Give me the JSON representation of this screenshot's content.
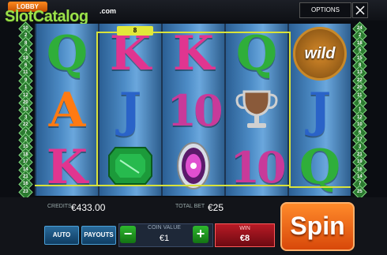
{
  "topbar": {
    "lobby_label": "LOBBY",
    "logo_text": "SlotCatalog",
    "logo_suffix": ".com",
    "options_label": "OPTIONS",
    "close_icon": "close-icon"
  },
  "paylines": {
    "left": [
      "10",
      "2",
      "8",
      "4",
      "19",
      "6",
      "11",
      "9",
      "1",
      "12",
      "20",
      "13",
      "3",
      "22",
      "7",
      "5",
      "15",
      "18",
      "17",
      "14",
      "21",
      "16",
      "23"
    ],
    "right": [
      "24",
      "2",
      "18",
      "5",
      "15",
      "8",
      "13",
      "22",
      "20",
      "11",
      "9",
      "1",
      "12",
      "10",
      "6",
      "17",
      "3",
      "21",
      "19",
      "16",
      "14",
      "7",
      "25"
    ]
  },
  "winline": {
    "tag": "8",
    "color": "#d9e23a"
  },
  "reels": [
    [
      {
        "sym": "Q",
        "color": "#2fae3a"
      },
      {
        "sym": "A",
        "color": "#ff7a12"
      },
      {
        "sym": "K",
        "color": "#e03590"
      }
    ],
    [
      {
        "sym": "K",
        "color": "#e03590"
      },
      {
        "sym": "J",
        "color": "#2a63c8"
      },
      {
        "sym": "emerald-gem-icon",
        "color": "#1c9a3a"
      }
    ],
    [
      {
        "sym": "K",
        "color": "#e03590"
      },
      {
        "sym": "10",
        "color": "#c83a9a"
      },
      {
        "sym": "pink-opal-gem-icon",
        "color": "#e04fd0"
      }
    ],
    [
      {
        "sym": "Q",
        "color": "#2fae3a"
      },
      {
        "sym": "silver-trophy-icon",
        "color": "#d0d0d0"
      },
      {
        "sym": "10",
        "color": "#c83a9a"
      }
    ],
    [
      {
        "sym": "wild",
        "color": "#ff8a1f"
      },
      {
        "sym": "J",
        "color": "#2a63c8"
      },
      {
        "sym": "Q",
        "color": "#2fae3a"
      }
    ]
  ],
  "bottom": {
    "credits_label": "CREDITS",
    "credits_value": "€433.00",
    "total_bet_label": "TOTAL BET",
    "total_bet_value": "€25",
    "auto_label": "AUTO",
    "payouts_label": "PAYOUTS",
    "coin_value_label": "COIN VALUE",
    "coin_value": "€1",
    "minus_glyph": "−",
    "plus_glyph": "+",
    "win_label": "WIN",
    "win_value": "€8",
    "spin_label": "Spin"
  }
}
